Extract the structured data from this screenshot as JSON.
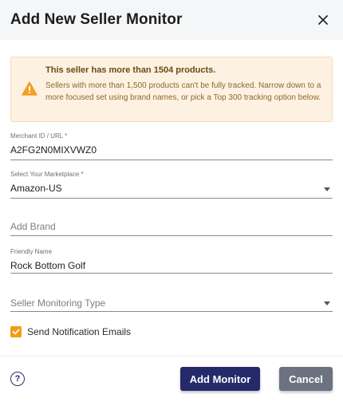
{
  "dialog": {
    "title": "Add New Seller Monitor"
  },
  "alert": {
    "title": "This seller has more than 1504 products.",
    "body": "Sellers with more than 1,500 products can't be fully tracked. Narrow down to a more focused set using brand names, or pick a Top 300 tracking option below.",
    "icon": "warning-icon",
    "color": "#f39c12"
  },
  "form": {
    "merchant": {
      "label": "Merchant ID / URL *",
      "value": "A2FG2N0MIXVWZ0"
    },
    "marketplace": {
      "label": "Select Your Marketplace *",
      "value": "Amazon-US"
    },
    "brand": {
      "placeholder": "Add Brand"
    },
    "friendly_name": {
      "label": "Friendly Name",
      "value": "Rock Bottom Golf"
    },
    "monitoring_type": {
      "placeholder": "Seller Monitoring Type"
    },
    "notifications": {
      "label": "Send Notification Emails",
      "checked": true
    }
  },
  "footer": {
    "help_icon": "question-circle-icon",
    "help_glyph": "?",
    "add_label": "Add Monitor",
    "cancel_label": "Cancel"
  },
  "colors": {
    "primary": "#252a6b",
    "secondary": "#6c7280",
    "accent": "#f39c12"
  }
}
